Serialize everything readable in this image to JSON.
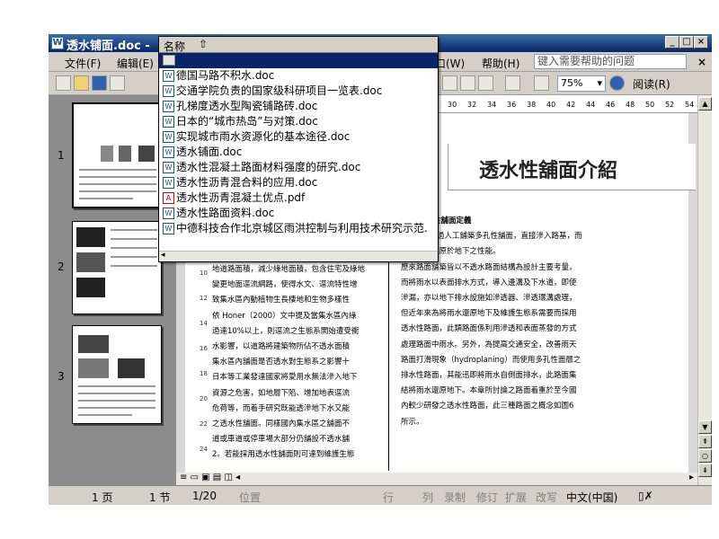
{
  "window": {
    "title": "透水铺面.doc -",
    "minimize": "_",
    "maximize": "□",
    "close": "×"
  },
  "menu": {
    "items": [
      {
        "label": "文件(F)"
      },
      {
        "label": "编辑(E)"
      },
      {
        "label": "口(W)"
      },
      {
        "label": "帮助(H)"
      }
    ],
    "help_placeholder": "键入需要帮助的问题",
    "close_doc": "×"
  },
  "toolbar": {
    "zoom": "75%",
    "read_label": "阅读(R)"
  },
  "ruler": {
    "ticks": [
      "30",
      "32",
      "34",
      "36",
      "38",
      "40",
      "42",
      "44",
      "46",
      "48",
      "50",
      "52",
      "54"
    ]
  },
  "thumbnails": [
    {
      "num": "1"
    },
    {
      "num": "2"
    },
    {
      "num": "3"
    }
  ],
  "dropdown": {
    "header": "名称",
    "items": [
      {
        "label": "德国马路不积水.doc",
        "type": "doc"
      },
      {
        "label": "交通学院负责的国家级科研项目一览表.doc",
        "type": "doc"
      },
      {
        "label": "孔梯度透水型陶瓷铺路砖.doc",
        "type": "doc"
      },
      {
        "label": "日本的“城市热岛”与对策.doc",
        "type": "doc"
      },
      {
        "label": "实现城市雨水资源化的基本途径.doc",
        "type": "doc"
      },
      {
        "label": "透水铺面.doc",
        "type": "doc"
      },
      {
        "label": "透水性混凝土路面材料强度的研究.doc",
        "type": "doc"
      },
      {
        "label": "透水性沥青混合料的应用.doc",
        "type": "doc"
      },
      {
        "label": "透水性沥青混凝土优点.pdf",
        "type": "pdf"
      },
      {
        "label": "透水性路面资料.doc",
        "type": "doc"
      },
      {
        "label": "中德科技合作北京城区雨洪控制与利用技术研究示范.",
        "type": "doc"
      }
    ]
  },
  "document": {
    "heading": "透水性舖面介紹",
    "col2": [
      "性舖面定義",
      "過人工鋪築多孔性舖面，直接滲入路基，而",
      "具有使水還原於地下之性能。",
      "",
      "歷來路面舖築皆以不透水路面結構為設計主要考量，",
      "而將雨水以表面排水方式，導入邊溝及下水道，即使",
      "滲漏，亦以地下排水設施如滲透器、滲透環溝處理，",
      "但近年來為將雨水還原地下及維護生態系需要而採用",
      "透水性路面，此類路面係利用滲透和表面蒸發的方式",
      "處理路面中雨水。另外，為提高交通安全，改善雨天",
      "路面打滑現象（hydroplaning）而使用多孔性面層之",
      "排水性路面，其能迅即將雨水自側面排水，此路面集",
      "結將雨水還原地下。本章所討論之路面着重於至今國",
      "內較少研發之透水性路面，此三種路面之概念如圖6",
      "所示。"
    ],
    "col1": [
      "地道路面積，減少綠地面積，包含住宅及綠地",
      "變更地面逕流網路，使得水文、逕流特性增",
      "致集水區內動植物生長棲地和生物多樣性",
      "依 Honer（2000）文中提及當集水區內綠",
      "過達10%以上，則逕流之生態系開始遭受衝",
      "水影響，以道路將建築物所佔不透水面積",
      "集水區內舖面是否透水對生態系之影響十",
      "日本等工業發達國家將愛用水無法滲入地下",
      "資源之危害，如地層下陷、增加地表逕流",
      "危荷等，而着手研究既能透滲地下水又能",
      "之透水性舖面。同樣國內集水區之舖面不",
      "道或車道或停車場大部分仍舖設不透水舖",
      "2。若能採用透水性舖面則可達到維護生態"
    ],
    "line_numbers": [
      "10",
      "12",
      "14",
      "16",
      "18",
      "20",
      "22",
      "24"
    ]
  },
  "status": {
    "page": "1 页",
    "section": "1 节",
    "pages": "1/20",
    "position": "位置",
    "rec": "录制",
    "trk": "修订",
    "ext": "扩展",
    "ovr": "改写",
    "lang": "中文(中国)",
    "row": "行",
    "col": "列"
  }
}
